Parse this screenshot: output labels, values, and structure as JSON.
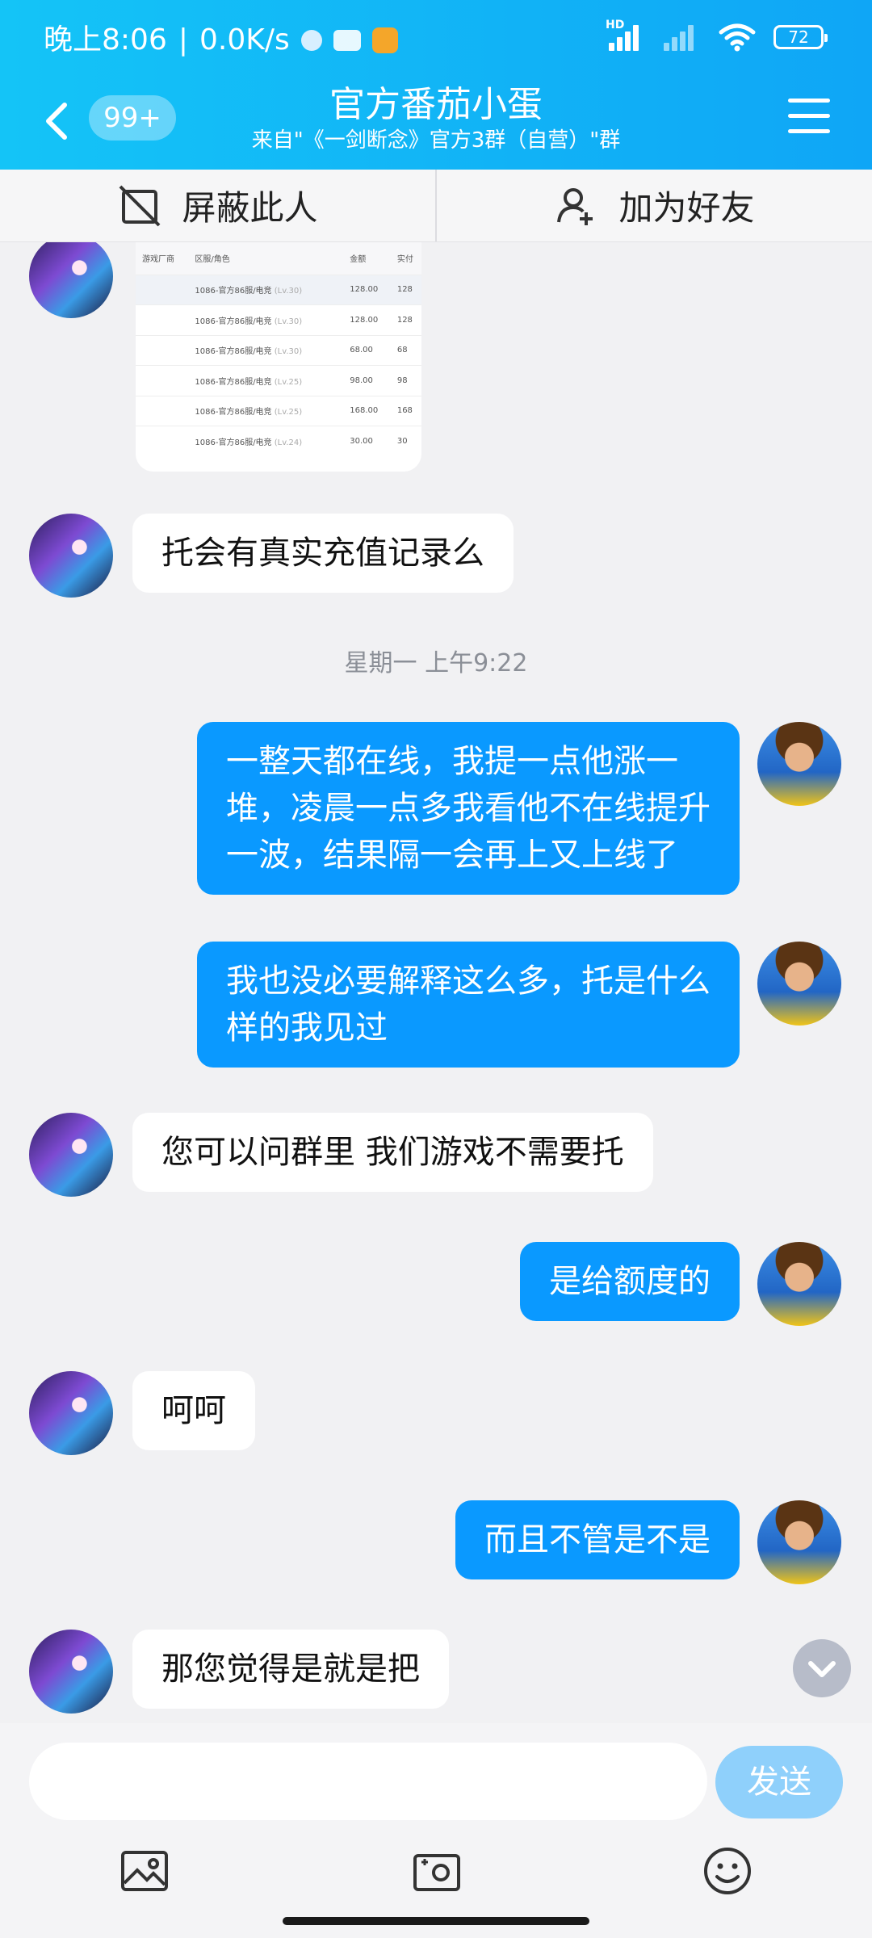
{
  "status_bar": {
    "time": "晚上8:06",
    "speed": "0.0K/s",
    "hd": "HD",
    "battery": "72"
  },
  "header": {
    "unread_badge": "99+",
    "title": "官方番茄小蛋",
    "subtitle": "来自\"《一剑断念》官方3群（自营）\"群"
  },
  "actions": {
    "block_label": "屏蔽此人",
    "add_friend_label": "加为好友"
  },
  "image_table": {
    "headers": [
      "游戏厂商",
      "区服/角色",
      "金额",
      "实付"
    ],
    "rows": [
      {
        "server": "1086-官方86服/电竞",
        "lv": "(Lv.30)",
        "amount": "128.00",
        "paid": "128"
      },
      {
        "server": "1086-官方86服/电竞",
        "lv": "(Lv.30)",
        "amount": "128.00",
        "paid": "128"
      },
      {
        "server": "1086-官方86服/电竞",
        "lv": "(Lv.30)",
        "amount": "68.00",
        "paid": "68"
      },
      {
        "server": "1086-官方86服/电竞",
        "lv": "(Lv.25)",
        "amount": "98.00",
        "paid": "98"
      },
      {
        "server": "1086-官方86服/电竞",
        "lv": "(Lv.25)",
        "amount": "168.00",
        "paid": "168"
      },
      {
        "server": "1086-官方86服/电竞",
        "lv": "(Lv.24)",
        "amount": "30.00",
        "paid": "30"
      }
    ]
  },
  "messages": [
    {
      "from": "other",
      "text": "托会有真实充值记录么"
    },
    {
      "from": "system",
      "text": "星期一 上午9:22"
    },
    {
      "from": "me",
      "text": "一整天都在线，我提一点他涨一\n堆，凌晨一点多我看他不在线提升\n一波，结果隔一会再上又上线了"
    },
    {
      "from": "me",
      "text": "我也没必要解释这么多，托是什么\n样的我见过"
    },
    {
      "from": "other",
      "text": "您可以问群里 我们游戏不需要托"
    },
    {
      "from": "me",
      "text": "是给额度的"
    },
    {
      "from": "other",
      "text": "呵呵"
    },
    {
      "from": "me",
      "text": "而且不管是不是"
    },
    {
      "from": "other",
      "text": "那您觉得是就是把"
    }
  ],
  "compose": {
    "input_value": "",
    "send_label": "发送"
  },
  "colors": {
    "header_blue": "#0fa6f6",
    "my_bubble": "#0a99ff",
    "send_disabled": "#8fd0fb"
  },
  "icons": [
    "back-icon",
    "menu-icon",
    "block-icon",
    "add-friend-icon",
    "image-icon",
    "camera-icon",
    "emoji-icon",
    "chevron-down-icon"
  ]
}
